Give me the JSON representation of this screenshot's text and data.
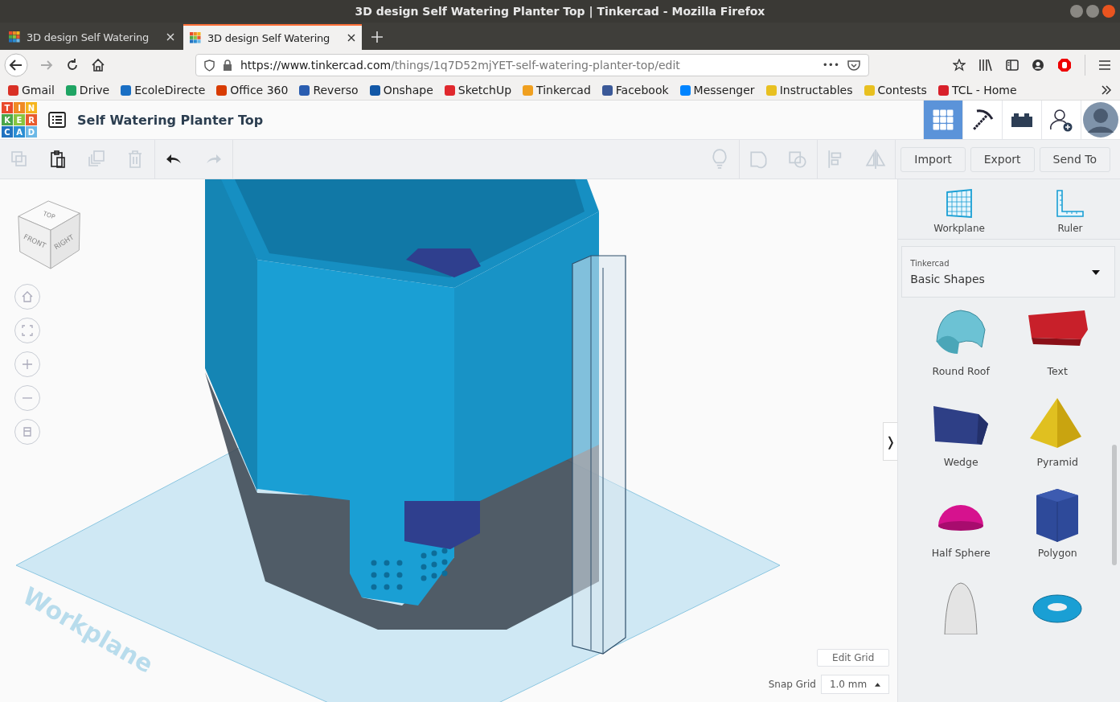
{
  "window": {
    "title": "3D design Self Watering Planter Top | Tinkercad - Mozilla Firefox"
  },
  "tabs": [
    {
      "label": "3D design Self Watering",
      "selected": false
    },
    {
      "label": "3D design Self Watering",
      "selected": true
    }
  ],
  "address_bar": {
    "url_host": "https://www.tinkercad.com",
    "url_path": "/things/1q7D52mjYET-self-watering-planter-top/edit",
    "more": "•••"
  },
  "bookmarks": [
    {
      "label": "Gmail",
      "color": "#d93025"
    },
    {
      "label": "Drive",
      "color": "#1fa463"
    },
    {
      "label": "EcoleDirecte",
      "color": "#1a6fc4"
    },
    {
      "label": "Office 360",
      "color": "#d83b01"
    },
    {
      "label": "Reverso",
      "color": "#2a5db0"
    },
    {
      "label": "Onshape",
      "color": "#1257a6"
    },
    {
      "label": "SketchUp",
      "color": "#e0282d"
    },
    {
      "label": "Tinkercad",
      "color": "#f0a020"
    },
    {
      "label": "Facebook",
      "color": "#3b5998"
    },
    {
      "label": "Messenger",
      "color": "#0084ff"
    },
    {
      "label": "Instructables",
      "color": "#e8c020"
    },
    {
      "label": "Contests",
      "color": "#e8c020"
    },
    {
      "label": "TCL - Home",
      "color": "#d8202a"
    }
  ],
  "app_header": {
    "logo_letters": [
      "T",
      "I",
      "N",
      "K",
      "E",
      "R",
      "C",
      "A",
      "D"
    ],
    "design_title": "Self Watering Planter Top",
    "nav": [
      {
        "kind": "grid",
        "selected": true
      },
      {
        "kind": "pickaxe",
        "selected": false
      },
      {
        "kind": "brick",
        "selected": false
      },
      {
        "kind": "add-user",
        "selected": false
      },
      {
        "kind": "avatar",
        "selected": false
      }
    ]
  },
  "toolbar": {
    "left": [
      {
        "kind": "copy",
        "disabled": true
      },
      {
        "kind": "paste",
        "disabled": false
      },
      {
        "kind": "duplicate",
        "disabled": true
      },
      {
        "kind": "delete",
        "disabled": true
      },
      {
        "kind": "undo",
        "disabled": false
      },
      {
        "kind": "redo",
        "disabled": true
      }
    ],
    "right": [
      {
        "kind": "light",
        "disabled": true
      },
      {
        "kind": "group",
        "disabled": true
      },
      {
        "kind": "ungroup",
        "disabled": true
      },
      {
        "kind": "align",
        "disabled": true
      },
      {
        "kind": "mirror",
        "disabled": true
      }
    ],
    "buttons": [
      "Import",
      "Export",
      "Send To"
    ]
  },
  "viewport": {
    "view_cube": {
      "top": "TOP",
      "front": "FRONT",
      "right": "RIGHT"
    },
    "workplane_label": "Workplane",
    "view_controls": [
      {
        "kind": "home"
      },
      {
        "kind": "fit"
      },
      {
        "kind": "zoom-in"
      },
      {
        "kind": "zoom-out"
      },
      {
        "kind": "ortho"
      }
    ],
    "edit_grid": "Edit Grid",
    "snap_grid_label": "Snap Grid",
    "snap_grid_value": "1.0 mm",
    "panel_toggle": "❭"
  },
  "shapes_panel": {
    "tools": [
      {
        "kind": "workplane",
        "label": "Workplane"
      },
      {
        "kind": "ruler",
        "label": "Ruler"
      }
    ],
    "library": {
      "caption": "Tinkercad",
      "value": "Basic Shapes"
    },
    "shapes": [
      {
        "kind": "roof",
        "label": "Round Roof"
      },
      {
        "kind": "text",
        "label": "Text"
      },
      {
        "kind": "wedge",
        "label": "Wedge"
      },
      {
        "kind": "pyramid",
        "label": "Pyramid"
      },
      {
        "kind": "half-sphere",
        "label": "Half Sphere"
      },
      {
        "kind": "polygon",
        "label": "Polygon"
      },
      {
        "kind": "paraboloid"
      },
      {
        "kind": "torus"
      }
    ]
  }
}
